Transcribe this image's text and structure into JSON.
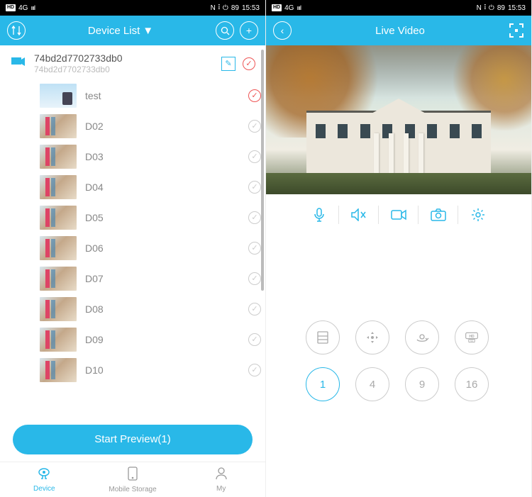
{
  "status": {
    "carrier": "HD",
    "net": "4G",
    "signal": "ıııl",
    "icons": "N ⠇⏻",
    "battery": "89",
    "time": "15:53"
  },
  "left": {
    "header_title": "Device List",
    "device": {
      "name": "74bd2d7702733db0",
      "sub": "74bd2d7702733db0"
    },
    "channels": [
      {
        "label": "test",
        "selected": true
      },
      {
        "label": "D02",
        "selected": false
      },
      {
        "label": "D03",
        "selected": false
      },
      {
        "label": "D04",
        "selected": false
      },
      {
        "label": "D05",
        "selected": false
      },
      {
        "label": "D06",
        "selected": false
      },
      {
        "label": "D07",
        "selected": false
      },
      {
        "label": "D08",
        "selected": false
      },
      {
        "label": "D09",
        "selected": false
      },
      {
        "label": "D10",
        "selected": false
      }
    ],
    "start_btn": "Start Preview(1)",
    "nav": {
      "device": "Device",
      "storage": "Mobile Storage",
      "my": "My"
    }
  },
  "right": {
    "header_title": "Live Video",
    "grid": {
      "a": "1",
      "b": "4",
      "c": "9",
      "d": "16"
    }
  }
}
